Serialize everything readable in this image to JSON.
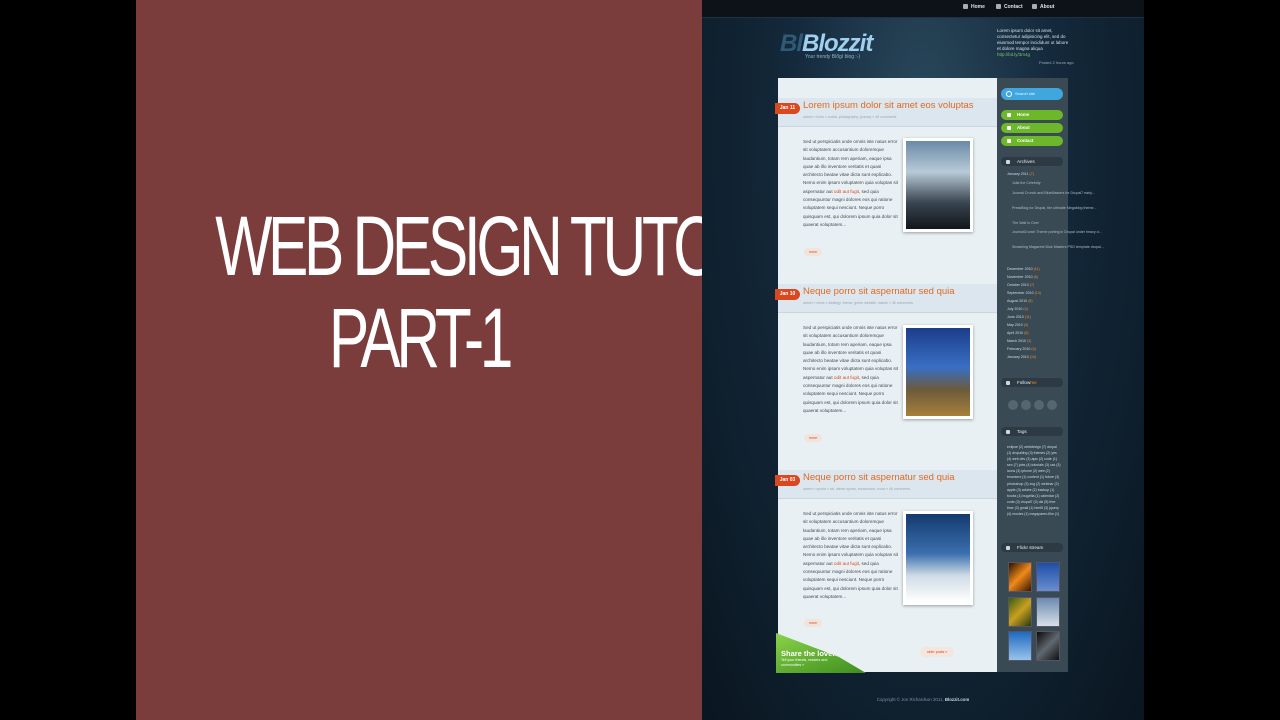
{
  "tutorial": {
    "line1": "WEB DESIGN TUTORIAL",
    "line2": "PART-1"
  },
  "colors": {
    "left_panel": "#7b3c3c",
    "accent_orange": "#e06a22",
    "date_tag": "#d9481e",
    "menu_green": "#6cb72a",
    "search_blue": "#3fa7de"
  },
  "nav": {
    "home": "Home",
    "contact": "Contact",
    "about": "About"
  },
  "site": {
    "logo_faded": "Bl",
    "logo": "Blozzit",
    "tagline": "Your trendy Blőgí blog :-)",
    "header_text": "Lorem ipsum dolor sit amet, consectetur adipisicing elit, sed do eiusmod tempor incididunt ut labore et dolore magna aliqua",
    "header_link": "http://bit.ly/3m4g",
    "posted": "Posted 2 hours ago"
  },
  "posts": [
    {
      "date": "Jan 11",
      "title": "Lorem ipsum dolor sit amet eos voluptas",
      "meta": "admin » fonts » social, photography, journey » 46 comments",
      "body_before": "Sed ut perspiciatis unde omnis iste natus error sit voluptatem accusantium doloremque laudantium, totam rem aperiam, eaque ipsa quae ab illo inventore veritatis et quasi architecto beatae vitae dicta sunt explicabo. Nemo enim ipsam voluptatem quia voluptas sit aspernatur aut ",
      "body_link": "odit aut fugit",
      "body_after": ", sed quia consequuntur magni dolores eos qui ratione voluptatem sequi nesciunt. Neque porro quisquam est, qui dolorem ipsum quia dolor sit quaerat voluptatem...",
      "more": "more"
    },
    {
      "date": "Jan 10",
      "title": "Neque porro sit aspernatur sed quia",
      "meta": "admin » news » strategy, theme, green website, nature » 46 comments",
      "body_before": "Sed ut perspiciatis unde omnis iste natus error sit voluptatem accusantium doloremque laudantium, totam rem aperiam, eaque ipsa quae ab illo inventore veritatis et quasi architecto beatae vitae dicta sunt explicabo. Nemo enim ipsam voluptatem quia voluptas sit aspernatur aut ",
      "body_link": "odit aut fugit",
      "body_after": ", sed quia consequuntur magni dolores eos qui ratione voluptatem sequi nesciunt. Neque porro quisquam est, qui dolorem ipsum quia dolor sit quaerat voluptatem...",
      "more": "more"
    },
    {
      "date": "Jan 03",
      "title": "Neque porro sit aspernatur sed quia",
      "meta": "admin » sports » ski, winter sports, snowboard, snow » 46 comments",
      "body_before": "Sed ut perspiciatis unde omnis iste natus error sit voluptatem accusantium doloremque laudantium, totam rem aperiam, eaque ipsa quae ab illo inventore veritatis et quasi architecto beatae vitae dicta sunt explicabo. Nemo enim ipsam voluptatem quia voluptas sit aspernatur aut ",
      "body_link": "odit aut fugit",
      "body_after": ", sed quia consequuntur magni dolores eos qui ratione voluptatem sequi nesciunt. Neque porro quisquam est, qui dolorem ipsum quia dolor sit quaerat voluptatem...",
      "more": "more"
    }
  ],
  "older_posts": "older posts »",
  "share": {
    "title": "Share the love!",
    "subtitle": "Tell your friends, readers and communities »"
  },
  "sidebar": {
    "search_placeholder": "Search site",
    "menu": [
      "Home",
      "About",
      "Contact"
    ],
    "archives_title": "Archives",
    "archives_current": "January 2011",
    "archives_current_count": "(7)",
    "archives_posts": [
      "Julia the Celebrity",
      "Journal Crunch and BlueMasters for Drupal7 early...",
      "PressBlog for Drupal, the ultimate Megablog theme...",
      "The Wait Is Over",
      "JournalCrunch Theme porting in Drupal under heavy d...",
      "Smashing Magazine Blue Masters PSD template drupal..."
    ],
    "archives_months": [
      {
        "month": "December 2010",
        "count": "(11)"
      },
      {
        "month": "November 2010",
        "count": "(8)"
      },
      {
        "month": "October 2010",
        "count": "(7)"
      },
      {
        "month": "September 2010",
        "count": "(14)"
      },
      {
        "month": "August 2010",
        "count": "(6)"
      },
      {
        "month": "July 2010",
        "count": "(4)"
      },
      {
        "month": "June 2010",
        "count": "(11)"
      },
      {
        "month": "May 2010",
        "count": "(9)"
      },
      {
        "month": "April 2010",
        "count": "(6)"
      },
      {
        "month": "March 2010",
        "count": "(3)"
      },
      {
        "month": "February 2010",
        "count": "(4)"
      },
      {
        "month": "January 2010",
        "count": "(10)"
      }
    ],
    "follow_title": "Follow",
    "follow_highlight": "me",
    "tags_title": "Tags",
    "tags": "eclipse (2) webdesign (7) drupal (1) dropailing (3) themes (2) yes (4) web dev (3) ajax (2) code (1) seo (7) jobs (4) tutorials (3) css (3) icons (3) iphone (2) web (2) browsers (1) content (1) future (3) photoshop (3) svg (2) webinar (2) apple (3) adobe (2) backup (1) books (1) bugzilla (1) calendar (2) code (3) drupal7 (3) dsl (5) free time (3) gmail (1) html5 (3) jquery (4) movies (1) megaparen-film (1)",
    "flickr_title": "Flickr stream"
  },
  "footer": {
    "text": "Copyright © Jon Richardson 2011, ",
    "brand": "Blozzit.com"
  }
}
